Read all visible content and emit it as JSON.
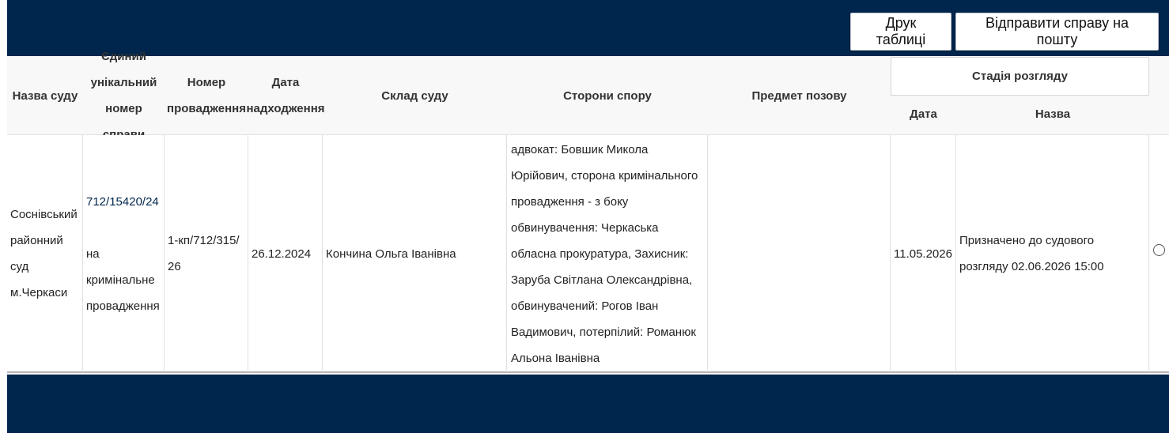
{
  "toolbar": {
    "print_label": "Друк таблиці",
    "mail_label": "Відправити справу на пошту"
  },
  "table": {
    "headers": {
      "court_name": "Назва суду",
      "case_number": "Єдиний унікальний номер справи",
      "proceeding_number": "Номер провадження",
      "received_date": "Дата надходження",
      "composition": "Склад суду",
      "parties": "Сторони спору",
      "subject": "Предмет позову",
      "stage": "Стадія розгляду",
      "stage_date": "Дата",
      "stage_name": "Назва"
    },
    "rows": [
      {
        "court_name": "Соснівський районний суд м.Черкаси",
        "case_number": "712/15420/24",
        "case_type": "на кримінальне провадження",
        "proceeding_number": "1-кп/712/315/26",
        "received_date": "26.12.2024",
        "composition": "Кончина Ольга Іванівна",
        "parties": "адвокат: Бовшик Микола Юрійович, сторона кримінального провадження - з боку обвинувачення: Черкаська обласна прокуратура, Захисник: Заруба Світлана Олександрівна, обвинувачений: Рогов Іван Вадимович, потерпілий: Романюк Альона Іванівна",
        "subject": "",
        "stage_date": "11.05.2026",
        "stage_name": "Призначено до судового розгляду 02.06.2026 15:00"
      }
    ]
  },
  "colors": {
    "bar": "#00264d",
    "header_bg": "#f8f8f8",
    "link": "#00264d"
  }
}
